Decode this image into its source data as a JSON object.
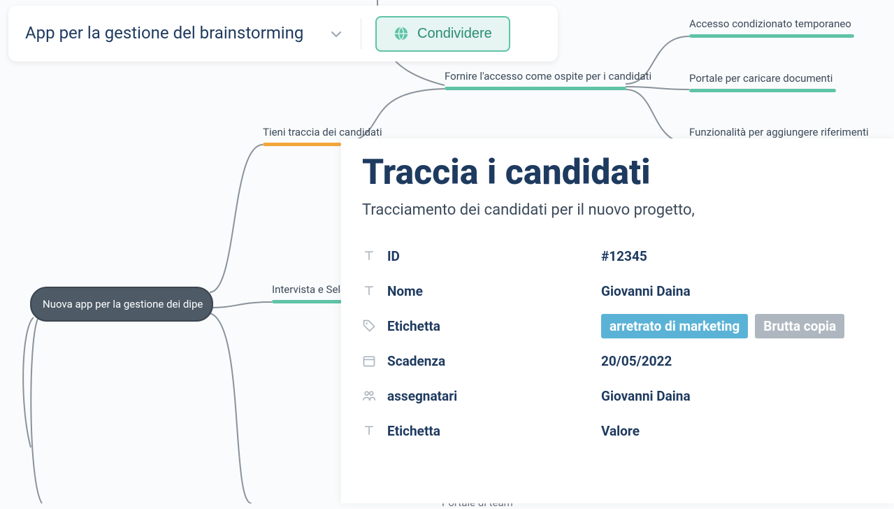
{
  "topbar": {
    "title": "App per la gestione del brainstorming",
    "share_label": "Condividere"
  },
  "mindmap": {
    "root": "Nuova app per la gestione dei dipe",
    "n1": "Tieni traccia dei candidati",
    "n2": "Intervista e Sele",
    "n3": "Fornire l'accesso come ospite per i candidati",
    "leaf1": "Accesso condizionato temporaneo",
    "leaf2": "Portale per caricare documenti",
    "leaf3": "Funzionalità per aggiungere riferimenti",
    "bottom": "Portale di team"
  },
  "panel": {
    "title": "Traccia i candidati",
    "subtitle": "Tracciamento dei candidati per il nuovo progetto,",
    "rows": {
      "id": {
        "label": "ID",
        "value": "#12345"
      },
      "name": {
        "label": "Nome",
        "value": "Giovanni Daina"
      },
      "tag": {
        "label": "Etichetta",
        "t1": "arretrato di marketing",
        "t2": "Brutta copia"
      },
      "due": {
        "label": "Scadenza",
        "value": "20/05/2022"
      },
      "assignees": {
        "label": "assegnatari",
        "value": "Giovanni Daina"
      },
      "extra": {
        "label": "Etichetta",
        "value": "Valore"
      }
    }
  }
}
